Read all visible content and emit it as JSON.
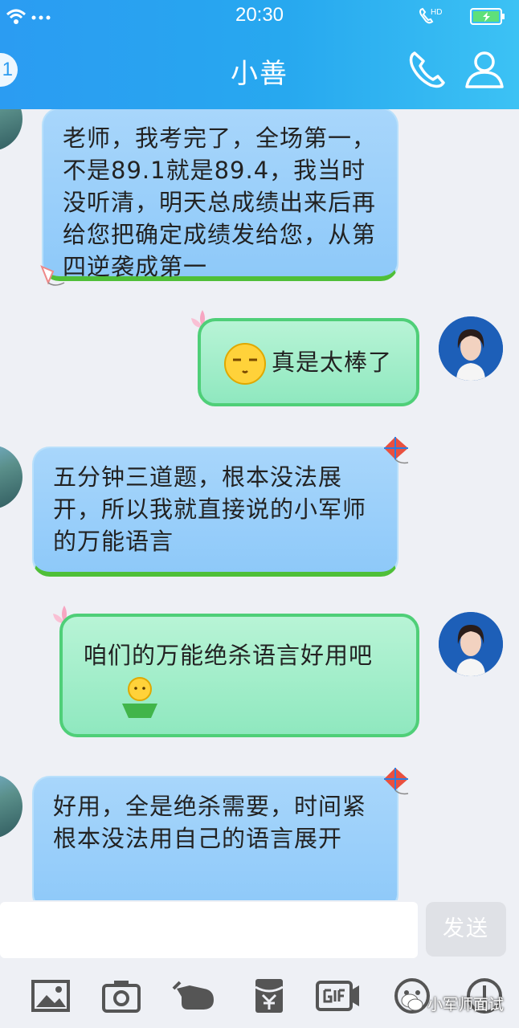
{
  "status_bar": {
    "time": "20:30",
    "network": "HD"
  },
  "header": {
    "title": "小善",
    "unread_count": "1"
  },
  "messages": [
    {
      "side": "left",
      "text": "老师，我考完了，全场第一，不是89.1就是89.4，我当时没听清，明天总成绩出来后再给您把确定成绩发给您，从第四逆袭成第一"
    },
    {
      "side": "right",
      "text": "真是太棒了",
      "emoji": "smirk-face"
    },
    {
      "side": "left",
      "text": "五分钟三道题，根本没法展开，所以我就直接说的小军师的万能语言"
    },
    {
      "side": "right",
      "text": "咱们的万能绝杀语言好用吧",
      "emoji": "shrug-figure"
    },
    {
      "side": "left",
      "text": "好用，全是绝杀需要，时间紧根本没法用自己的语言展开"
    }
  ],
  "input": {
    "value": "",
    "placeholder": ""
  },
  "send_button": {
    "label": "发送"
  },
  "toolbar": [
    "image-icon",
    "camera-icon",
    "hand-icon",
    "red-packet-icon",
    "gif-icon",
    "emoji-icon",
    "more-icon"
  ],
  "watermark": {
    "text": "小军师面试"
  },
  "colors": {
    "header_blue": "#2b9cf2",
    "left_bubble": "#8ec9f9",
    "right_bubble": "#8fe8bf",
    "bubble_green_border": "#4fcf78"
  }
}
